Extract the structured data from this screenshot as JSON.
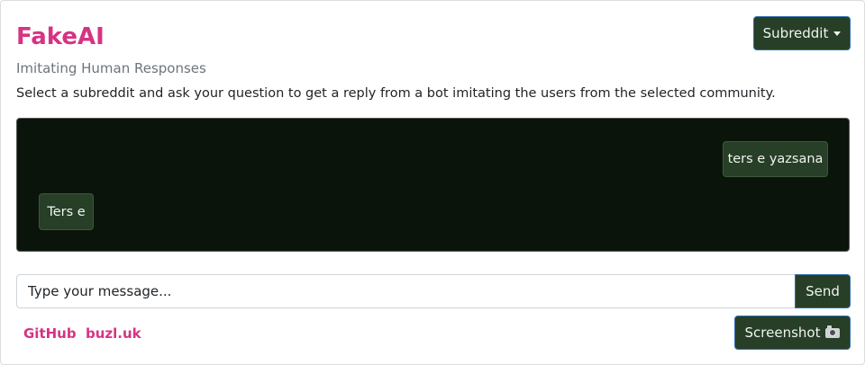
{
  "header": {
    "title": "FakeAI",
    "subtitle": "Imitating Human Responses",
    "description": "Select a subreddit and ask your question to get a reply from a bot imitating the users from the selected community."
  },
  "subreddit_dropdown": {
    "label": "Subreddit",
    "icon": "caret-down-icon"
  },
  "chat": {
    "messages": [
      {
        "sender": "user",
        "text": "ters e yazsana"
      },
      {
        "sender": "bot",
        "text": "Ters e"
      }
    ]
  },
  "composer": {
    "placeholder": "Type your message...",
    "send_label": "Send"
  },
  "footer": {
    "links": [
      "GitHub",
      "buzl.uk"
    ],
    "screenshot_label": "Screenshot",
    "screenshot_icon": "camera-icon"
  },
  "colors": {
    "accent": "#d63384",
    "button_bg": "#263f26",
    "chat_bg": "#0b140b",
    "muted_text": "#6c757d"
  }
}
